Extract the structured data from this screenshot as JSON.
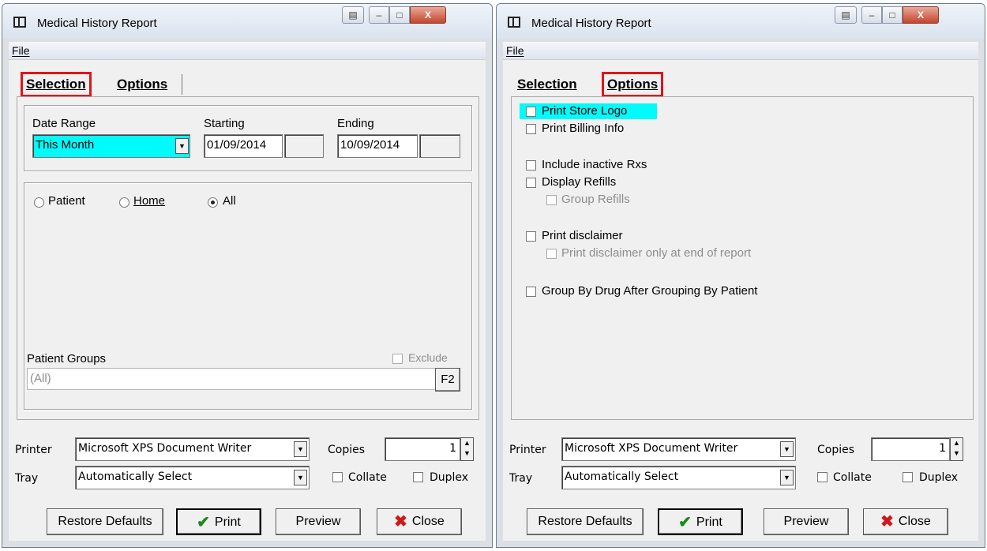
{
  "window_title": "Medical History Report",
  "menu": {
    "file": "File"
  },
  "tabs": {
    "selection": "Selection",
    "options": "Options"
  },
  "selection": {
    "date_range_label": "Date Range",
    "date_range_value": "This Month",
    "starting_label": "Starting",
    "starting_value": "01/09/2014",
    "ending_label": "Ending",
    "ending_value": "10/09/2014",
    "radio_patient": "Patient",
    "radio_home": "Home",
    "radio_all": "All",
    "selected_radio": "All",
    "patient_groups_label": "Patient Groups",
    "exclude_label": "Exclude",
    "patient_groups_value": "(All)",
    "f2_label": "F2"
  },
  "options": {
    "print_store_logo": "Print Store Logo",
    "print_billing_info": "Print Billing Info",
    "include_inactive": "Include inactive Rxs",
    "display_refills": "Display Refills",
    "group_refills": "Group Refills",
    "print_disclaimer": "Print disclaimer",
    "disclaimer_end": "Print disclaimer only at end of report",
    "group_by_drug": "Group By Drug After Grouping By Patient"
  },
  "printer": {
    "printer_label": "Printer",
    "printer_value": "Microsoft XPS Document Writer",
    "tray_label": "Tray",
    "tray_value": "Automatically Select",
    "copies_label": "Copies",
    "copies_value": "1",
    "collate_label": "Collate",
    "duplex_label": "Duplex"
  },
  "buttons": {
    "restore_defaults": "Restore Defaults",
    "print": "Print",
    "preview": "Preview",
    "close": "Close"
  },
  "colors": {
    "highlight": "#00fbfb",
    "callout": "#e0141a"
  }
}
